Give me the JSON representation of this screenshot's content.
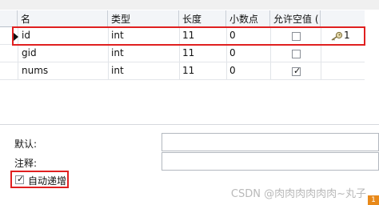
{
  "columns": [
    "名",
    "类型",
    "长度",
    "小数点",
    "允许空值 ("
  ],
  "rows": [
    {
      "name": "id",
      "type": "int",
      "length": "11",
      "decimals": "0",
      "nullable": false,
      "key": "1",
      "selected": true
    },
    {
      "name": "gid",
      "type": "int",
      "length": "11",
      "decimals": "0",
      "nullable": false,
      "key": "",
      "selected": false
    },
    {
      "name": "nums",
      "type": "int",
      "length": "11",
      "decimals": "0",
      "nullable": true,
      "key": "",
      "selected": false
    }
  ],
  "key_icon": "key-icon",
  "properties": {
    "default_label": "默认:",
    "comment_label": "注释:",
    "default_value": "",
    "comment_value": ""
  },
  "auto_increment": {
    "label": "自动递增",
    "checked": true
  },
  "watermark": "CSDN @肉肉肉肉肉肉~丸子",
  "corner_badge": "1",
  "colors": {
    "highlight": "#e02020",
    "header_bg": "#f3f5f8",
    "grid_line": "#e3e6ea"
  }
}
